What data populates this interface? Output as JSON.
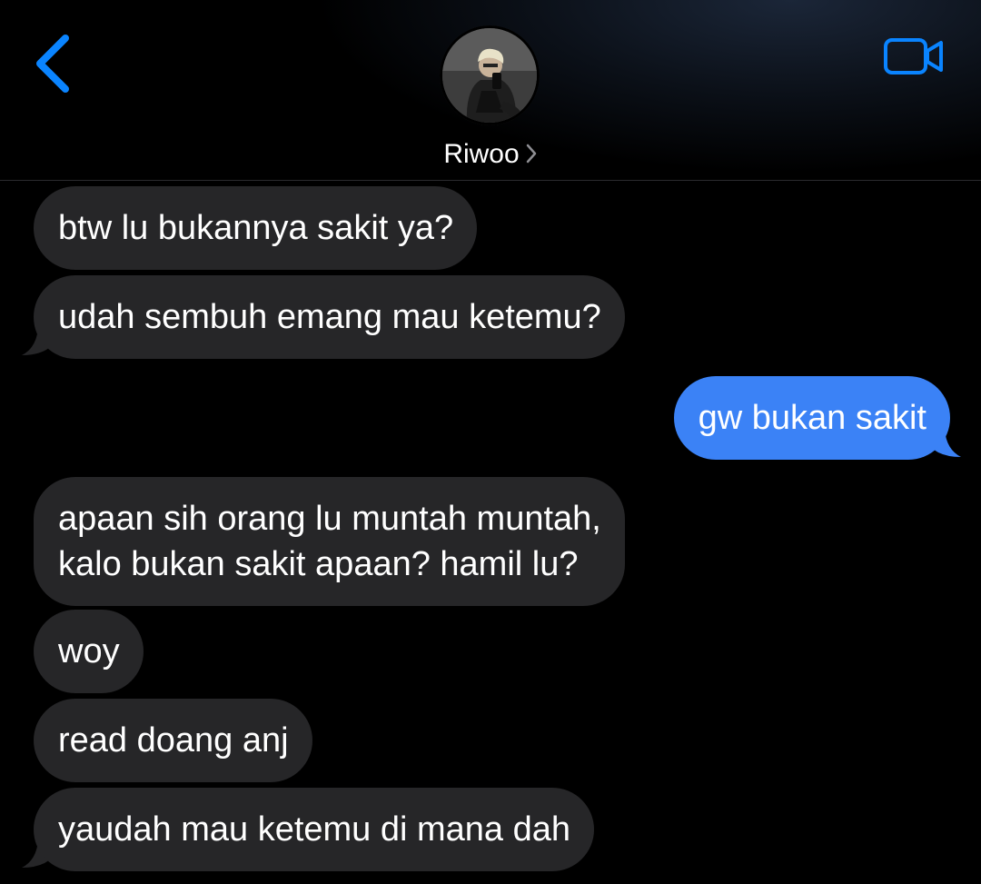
{
  "header": {
    "contact_name": "Riwoo",
    "back_icon": "chevron-left-icon",
    "video_icon": "video-camera-icon",
    "accent_color": "#0a84ff"
  },
  "messages": [
    {
      "direction": "received",
      "text": "btw lu bukannya sakit ya?",
      "tail": false
    },
    {
      "direction": "received",
      "text": "udah sembuh emang mau ketemu?",
      "tail": true
    },
    {
      "direction": "sent",
      "text": "gw bukan sakit",
      "tail": true
    },
    {
      "direction": "received",
      "lines": [
        "apaan sih orang lu muntah muntah,",
        "kalo bukan sakit apaan? hamil lu?"
      ],
      "tail": false
    },
    {
      "direction": "received",
      "text": "woy",
      "tail": false
    },
    {
      "direction": "received",
      "text": "read doang anj",
      "tail": false
    },
    {
      "direction": "received",
      "text": "yaudah mau ketemu di mana dah",
      "tail": true
    }
  ],
  "colors": {
    "received_bubble": "#262628",
    "sent_bubble": "#3b82f6",
    "background": "#000000"
  }
}
